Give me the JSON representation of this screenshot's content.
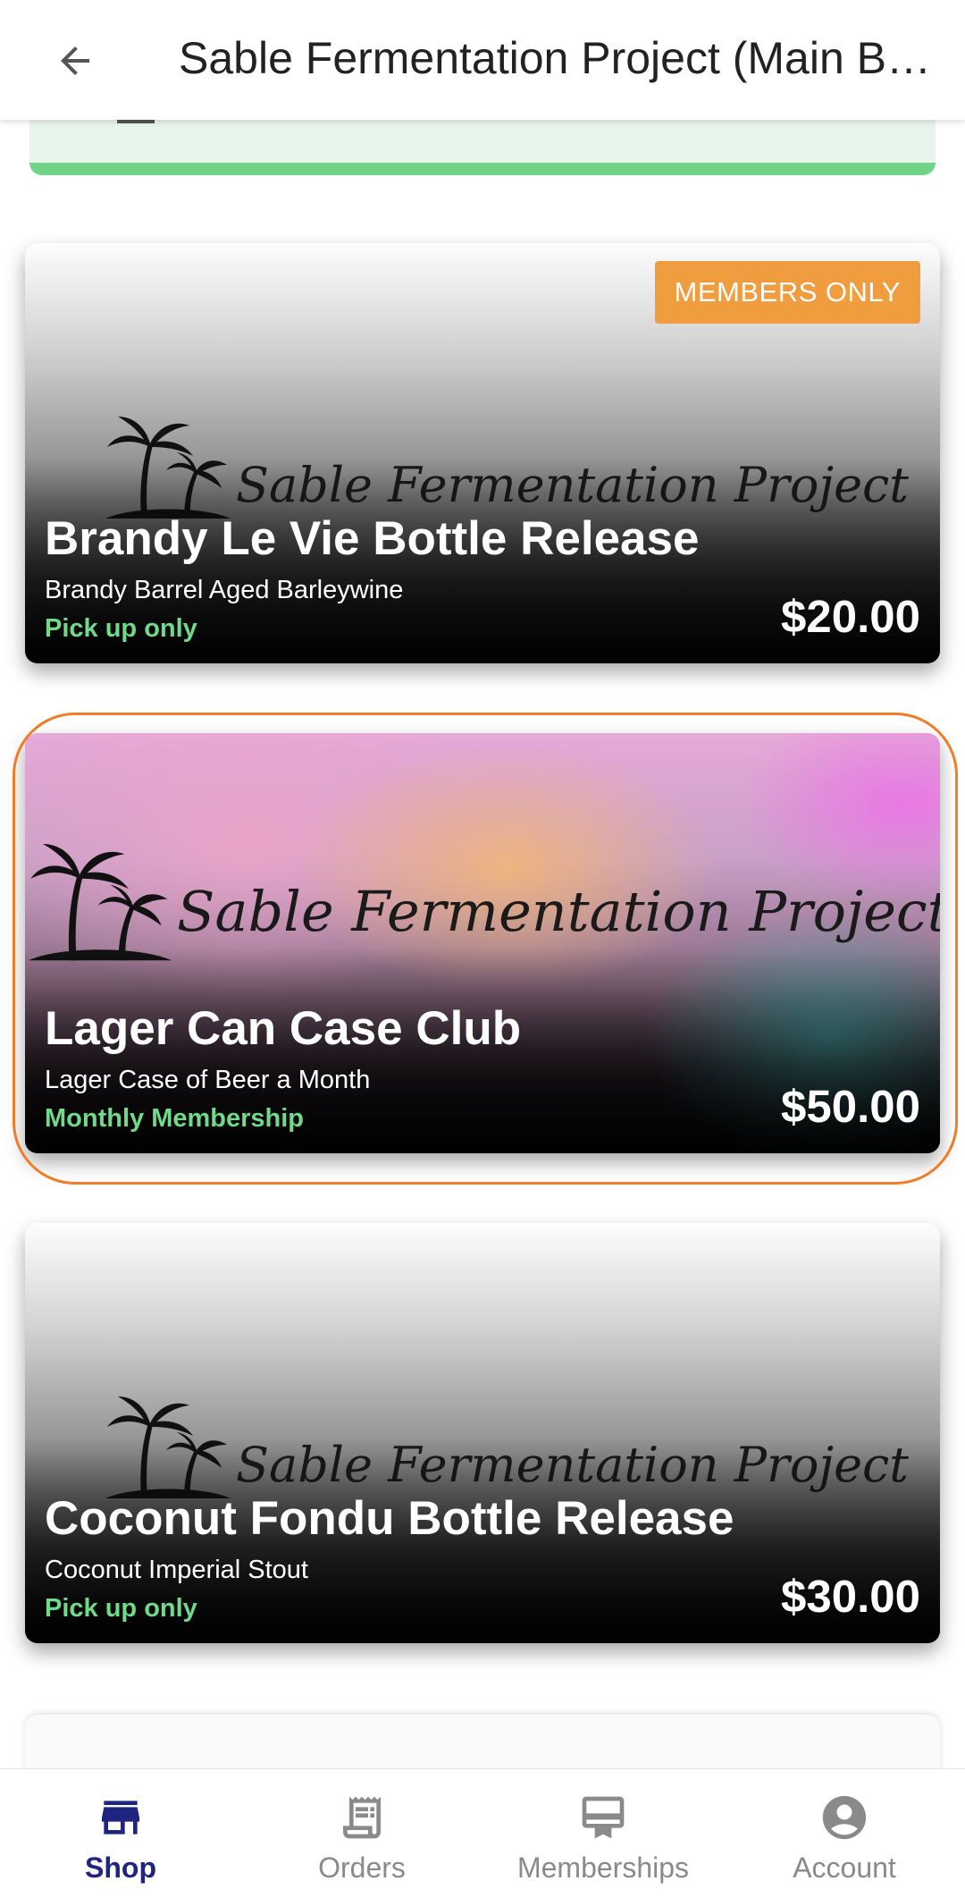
{
  "header": {
    "title": "Sable Fermentation Project (Main B…"
  },
  "logo_text": "Sable Fermentation Project",
  "products": [
    {
      "title": "Brandy Le Vie Bottle Release",
      "subtitle": "Brandy Barrel Aged Barleywine",
      "tag": "Pick up only",
      "price": "$20.00",
      "badge": "MEMBERS ONLY"
    },
    {
      "title": "Lager Can Case Club",
      "subtitle": "Lager Case of Beer a Month",
      "tag": "Monthly Membership",
      "price": "$50.00"
    },
    {
      "title": "Coconut Fondu Bottle Release",
      "subtitle": "Coconut Imperial Stout",
      "tag": "Pick up only",
      "price": "$30.00"
    }
  ],
  "nav": [
    {
      "label": "Shop",
      "icon": "store-icon",
      "active": true
    },
    {
      "label": "Orders",
      "icon": "receipt-icon",
      "active": false
    },
    {
      "label": "Memberships",
      "icon": "membership-card-icon",
      "active": false
    },
    {
      "label": "Account",
      "icon": "account-circle-icon",
      "active": false
    }
  ],
  "colors": {
    "accent_nav": "#1f2480",
    "tag_green": "#71d98a",
    "badge_orange": "#ef9d3e",
    "highlight_ring": "#f07d2a"
  }
}
